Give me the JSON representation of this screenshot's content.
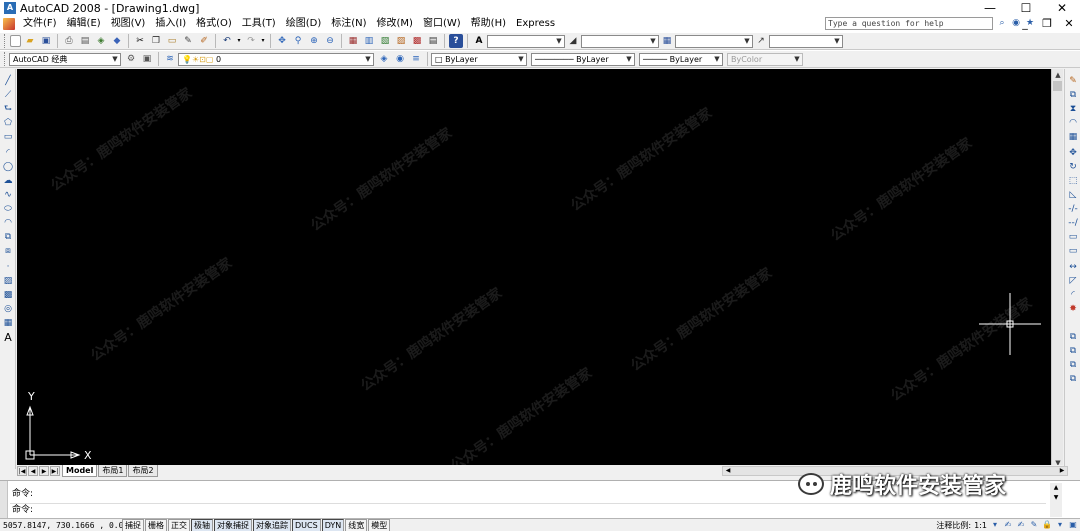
{
  "window": {
    "title": "AutoCAD 2008 - [Drawing1.dwg]",
    "app_icon": "A"
  },
  "window_controls": {
    "minimize": "—",
    "maximize": "☐",
    "close": "✕"
  },
  "menu": [
    "文件(F)",
    "编辑(E)",
    "视图(V)",
    "插入(I)",
    "格式(O)",
    "工具(T)",
    "绘图(D)",
    "标注(N)",
    "修改(M)",
    "窗口(W)",
    "帮助(H)",
    "Express"
  ],
  "help": {
    "placeholder": "Type a question for help"
  },
  "mdi_controls": {
    "minimize": "_",
    "restore": "❐",
    "close": "✕"
  },
  "workspace": {
    "selected": "AutoCAD 经典"
  },
  "layer": {
    "selected": "0"
  },
  "properties": {
    "color": "ByLayer",
    "linetype": "ByLayer",
    "lineweight": "ByLayer",
    "plotstyle": "ByColor"
  },
  "ucs": {
    "x_label": "X",
    "y_label": "Y"
  },
  "layout_tabs": [
    "Model",
    "布局1",
    "布局2"
  ],
  "command": {
    "line1": "命令:",
    "line2": "命令:"
  },
  "brand": {
    "text": "鹿鸣软件安装管家"
  },
  "watermark": {
    "text": "公众号：鹿鸣软件安装管家"
  },
  "status": {
    "coordinates": "5057.8147, 730.1666 , 0.0000",
    "buttons": [
      {
        "label": "捕捉",
        "on": false
      },
      {
        "label": "栅格",
        "on": false
      },
      {
        "label": "正交",
        "on": false
      },
      {
        "label": "极轴",
        "on": true
      },
      {
        "label": "对象捕捉",
        "on": true
      },
      {
        "label": "对象追踪",
        "on": true
      },
      {
        "label": "DUCS",
        "on": true
      },
      {
        "label": "DYN",
        "on": true
      },
      {
        "label": "线宽",
        "on": false
      },
      {
        "label": "模型",
        "on": false
      }
    ],
    "annotation_scale_label": "注释比例:",
    "annotation_scale_value": "1:1"
  },
  "colors": {
    "canvas": "#000000",
    "ucs": "#ffffff",
    "crosshair": "#ffffff"
  }
}
